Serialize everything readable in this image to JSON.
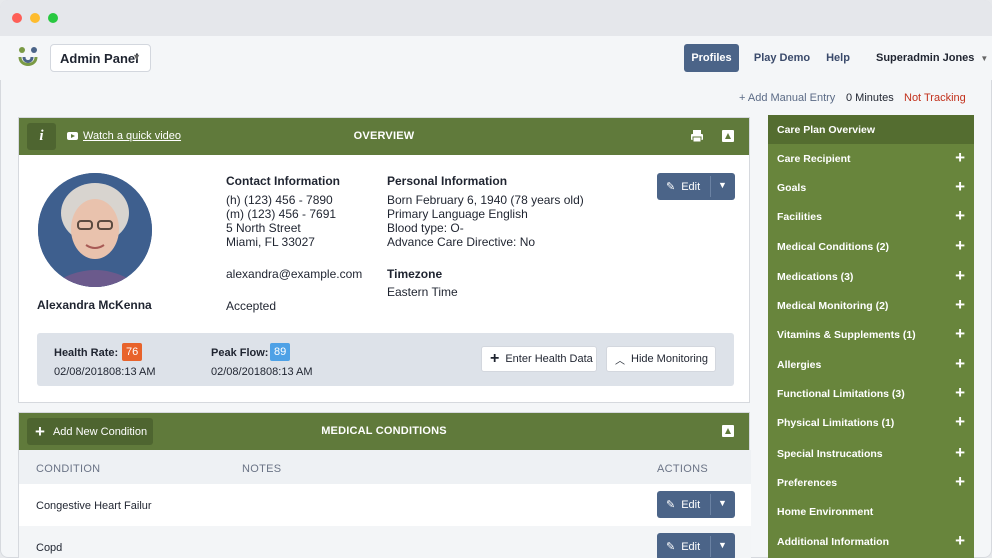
{
  "app": {
    "brand_select": "Admin Panel",
    "nav": {
      "profiles": "Profiles",
      "play_demo": "Play Demo",
      "help": "Help"
    },
    "user": "Superadmin Jones"
  },
  "tracking": {
    "manual_entry": "+ Add Manual Entry",
    "minutes": "0 Minutes",
    "status": "Not Tracking"
  },
  "overview": {
    "title": "OVERVIEW",
    "video_link": "Watch a quick video",
    "name": "Alexandra McKenna",
    "contact": {
      "heading": "Contact Information",
      "home": "(h) (123) 456 - 7890",
      "mobile": "(m) (123) 456 - 7691",
      "street": "5 North Street",
      "city": "Miami, FL 33027",
      "email": "alexandra@example.com",
      "status": "Accepted"
    },
    "personal": {
      "heading": "Personal Information",
      "born": "Born February 6, 1940 (78 years old)",
      "language": "Primary Language English",
      "blood": "Blood type: O-",
      "directive": "Advance Care Directive: No"
    },
    "timezone": {
      "heading": "Timezone",
      "value": "Eastern Time"
    },
    "edit_label": "Edit",
    "monitoring": {
      "health_rate": {
        "label": "Health Rate:",
        "value": "76",
        "date": "02/08/201808:13 AM",
        "color": "#e8632b"
      },
      "peak_flow": {
        "label": "Peak Flow:",
        "value": "89",
        "date": "02/08/201808:13 AM",
        "color": "#4ea1e6"
      },
      "enter_data": "Enter Health Data",
      "hide": "Hide Monitoring"
    }
  },
  "conditions": {
    "title": "MEDICAL CONDITIONS",
    "add_label": "Add New Condition",
    "columns": {
      "condition": "CONDITION",
      "notes": "NOTES",
      "actions": "ACTIONS"
    },
    "rows": [
      {
        "condition": "Congestive Heart Failur",
        "edit": "Edit"
      },
      {
        "condition": "Copd",
        "edit": "Edit"
      }
    ]
  },
  "sidebar": {
    "items": [
      {
        "label": "Care Plan Overview",
        "plus": ""
      },
      {
        "label": "Care Recipient",
        "plus": "+"
      },
      {
        "label": "Goals",
        "plus": "+"
      },
      {
        "label": "Facilities",
        "plus": "+"
      },
      {
        "label": "Medical Conditions (2)",
        "plus": "+"
      },
      {
        "label": "Medications (3)",
        "plus": "+"
      },
      {
        "label": "Medical Monitoring (2)",
        "plus": "+"
      },
      {
        "label": "Vitamins & Supplements (1)",
        "plus": "+"
      },
      {
        "label": "Allergies",
        "plus": "+"
      },
      {
        "label": "Functional Limitations (3)",
        "plus": "+"
      },
      {
        "label": "Physical Limitations (1)",
        "plus": "+"
      },
      {
        "label": "Special Instrucations",
        "plus": "+"
      },
      {
        "label": "Preferences",
        "plus": "+"
      },
      {
        "label": "Home Environment",
        "plus": ""
      },
      {
        "label": "Additional Information",
        "plus": "+"
      }
    ]
  },
  "colors": {
    "primary_blue": "#4b6488",
    "header_green": "#607a3b",
    "sidebar_green": "#68853c",
    "not_tracking_red": "#c2311c"
  }
}
